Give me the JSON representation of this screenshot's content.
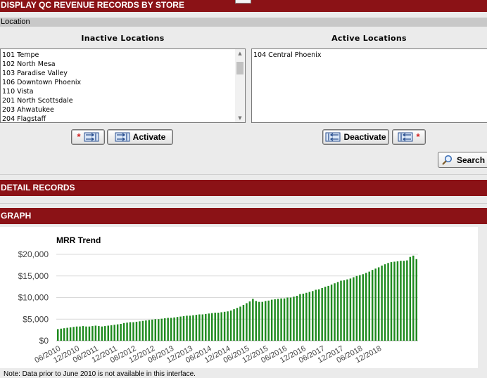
{
  "header": {
    "title": "DISPLAY QC REVENUE RECORDS BY STORE"
  },
  "location": {
    "section_label": "Location",
    "inactive_title": "Inactive Locations",
    "active_title": "Active Locations",
    "inactive_locations": [
      "101 Tempe",
      "102 North Mesa",
      "103 Paradise Valley",
      "106 Downtown Phoenix",
      "110 Vista",
      "201 North Scottsdale",
      "203 Ahwatukee",
      "204 Flagstaff"
    ],
    "active_locations": [
      "104 Central Phoenix"
    ],
    "activate_label": "Activate",
    "deactivate_label": "Deactivate",
    "search_label": "Search"
  },
  "sections": {
    "detail_records": "DETAIL RECORDS",
    "graph": "GRAPH"
  },
  "note": "Note: Data prior to June 2010 is not available in this interface.",
  "colors": {
    "header": "#8b1216",
    "bars": "#1e8a1e",
    "grid": "#d9d9d9"
  },
  "chart_data": {
    "type": "bar",
    "title": "MRR Trend",
    "xlabel": "",
    "ylabel": "",
    "ylim": [
      0,
      20000
    ],
    "ytick_labels": [
      "$0",
      "$5,000",
      "$10,000",
      "$15,000",
      "$20,000"
    ],
    "ytick_values": [
      0,
      5000,
      10000,
      15000,
      20000
    ],
    "xtick_labels": [
      "06/2010",
      "12/2010",
      "06/2011",
      "12/2011",
      "06/2012",
      "12/2012",
      "06/2013",
      "12/2013",
      "06/2014",
      "12/2014",
      "06/2015",
      "12/2015",
      "06/2016",
      "12/2016",
      "06/2017",
      "12/2017",
      "06/2018",
      "12/2018"
    ],
    "grid": true,
    "legend": "none",
    "series": [
      {
        "values": [
          2700,
          2800,
          2900,
          3000,
          3100,
          3200,
          3300,
          3300,
          3400,
          3300,
          3300,
          3400,
          3500,
          3400,
          3300,
          3400,
          3500,
          3600,
          3700,
          3800,
          3900,
          4100,
          4200,
          4300,
          4300,
          4400,
          4500,
          4600,
          4700,
          4800,
          4900,
          5000,
          5000,
          5100,
          5200,
          5300,
          5300,
          5400,
          5500,
          5600,
          5700,
          5800,
          5800,
          5900,
          6000,
          6100,
          6100,
          6200,
          6300,
          6400,
          6500,
          6500,
          6600,
          6700,
          6800,
          7000,
          7300,
          7600,
          7900,
          8300,
          8700,
          9100,
          9700,
          9200,
          9000,
          9000,
          9200,
          9300,
          9500,
          9600,
          9700,
          9800,
          9800,
          10000,
          10000,
          10200,
          10400,
          10800,
          10900,
          11100,
          11300,
          11500,
          11800,
          11900,
          12200,
          12500,
          12700,
          13000,
          13300,
          13600,
          13900,
          14000,
          14200,
          14400,
          14700,
          15000,
          15200,
          15400,
          15700,
          16000,
          16400,
          16700,
          17000,
          17400,
          17700,
          18000,
          18200,
          18300,
          18400,
          18500,
          18500,
          18600,
          19400,
          19700,
          18900
        ]
      }
    ]
  }
}
